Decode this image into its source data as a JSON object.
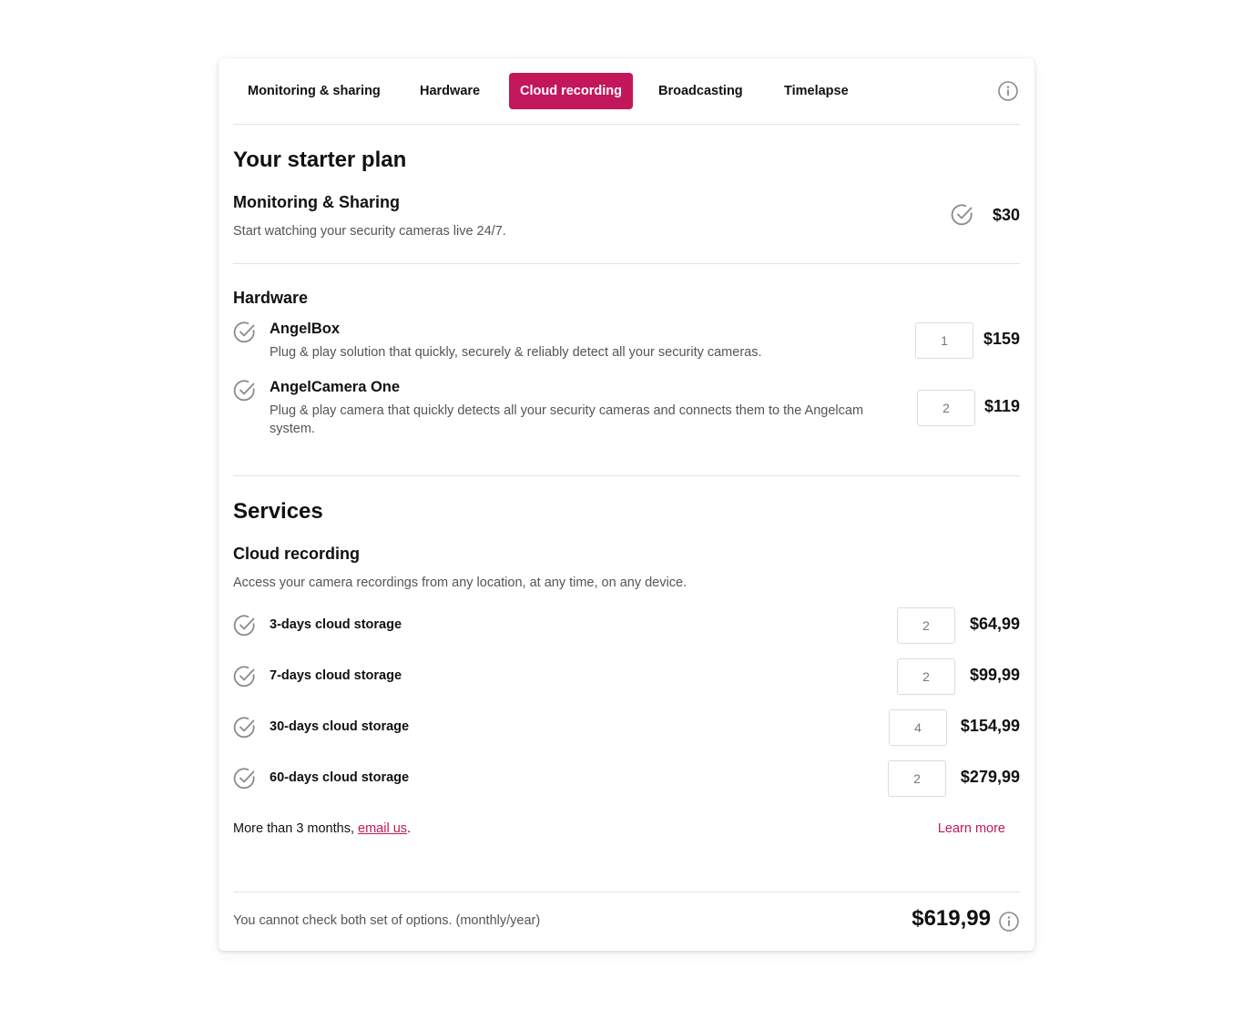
{
  "tabs": [
    {
      "label": "Monitoring & sharing"
    },
    {
      "label": "Hardware"
    },
    {
      "label": "Cloud recording",
      "active": true
    },
    {
      "label": "Broadcasting"
    },
    {
      "label": "Timelapse"
    }
  ],
  "starter": {
    "title": "Your starter plan",
    "monitoring": {
      "title": "Monitoring & Sharing",
      "description": "Start watching your security cameras live 24/7.",
      "price": "$30"
    }
  },
  "hardware": {
    "title": "Hardware",
    "items": [
      {
        "title": "AngelBox",
        "description": "Plug & play solution that quickly, securely & reliably detect all your security cameras.",
        "quantity": "1",
        "price": "$159"
      },
      {
        "title": "AngelCamera One",
        "description": "Plug & play camera that quickly detects all your security cameras and connects them to the Angelcam system.",
        "quantity": "2",
        "price": "$119"
      }
    ]
  },
  "services": {
    "title": "Services",
    "cloud_recording": {
      "title": "Cloud recording",
      "description": "Access your camera recordings from any location, at any time, on any device.",
      "options": [
        {
          "label": "3-days cloud storage",
          "quantity": "2",
          "price": "$64,99"
        },
        {
          "label": "7-days cloud storage",
          "quantity": "2",
          "price": "$99,99"
        },
        {
          "label": "30-days cloud storage",
          "quantity": "4",
          "price": "$154,99"
        },
        {
          "label": "60-days cloud storage",
          "quantity": "2",
          "price": "$279,99"
        }
      ],
      "more_text": "More than 3 months, ",
      "email_link": "email us",
      "more_suffix": ".",
      "learn_more": "Learn more"
    }
  },
  "footer": {
    "note": "You cannot check both set of options. (monthly/year)",
    "total": "$619,99"
  },
  "colors": {
    "accent": "#c2185b",
    "check": "#8a8a8a"
  },
  "icons": {
    "info": "info-circle-icon",
    "check": "check-circle-icon"
  }
}
